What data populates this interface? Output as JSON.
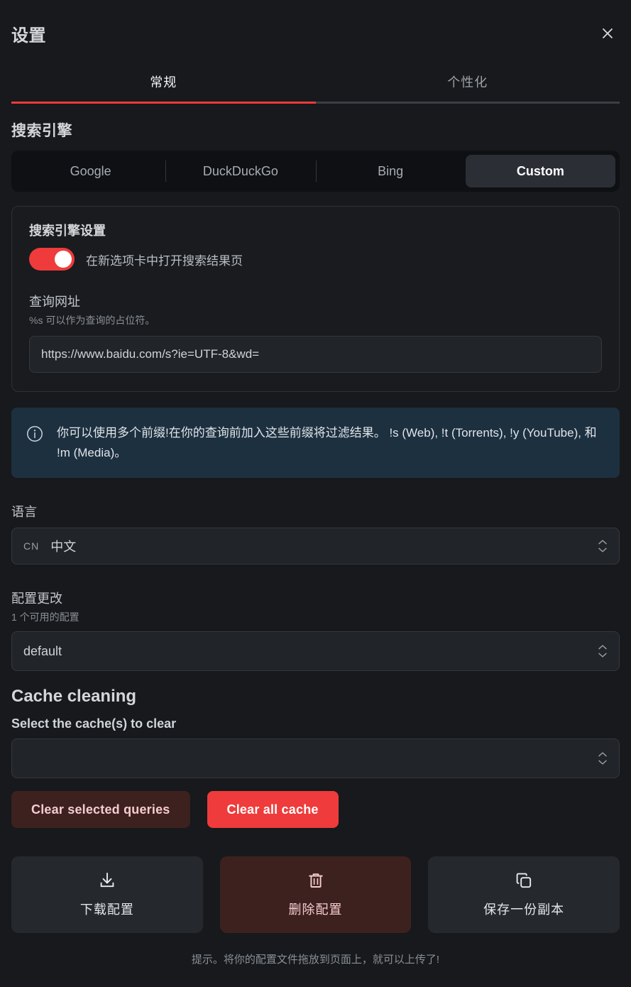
{
  "header": {
    "title": "设置",
    "close_icon": "close-icon"
  },
  "tabs": [
    {
      "label": "常规",
      "active": true
    },
    {
      "label": "个性化",
      "active": false
    }
  ],
  "search_engine": {
    "section_title": "搜索引擎",
    "options": [
      "Google",
      "DuckDuckGo",
      "Bing",
      "Custom"
    ],
    "selected": "Custom",
    "card": {
      "title": "搜索引擎设置",
      "toggle_label": "在新选项卡中打开搜索结果页",
      "toggle_on": true,
      "url_label": "查询网址",
      "url_hint": "%s 可以作为查询的占位符。",
      "url_value": "https://www.baidu.com/s?ie=UTF-8&wd=",
      "url_placeholder": "https://www.baidu.com/s?ie=UTF-8&wd="
    }
  },
  "info_banner": {
    "icon": "info-circle-icon",
    "text": "你可以使用多个前缀!在你的查询前加入这些前缀将过滤结果。 !s (Web), !t (Torrents), !y (YouTube), 和 !m (Media)。"
  },
  "language": {
    "label": "语言",
    "code": "CN",
    "value": "中文"
  },
  "config": {
    "label": "配置更改",
    "sub": "1 个可用的配置",
    "value": "default"
  },
  "cache": {
    "section_title": "Cache cleaning",
    "select_label": "Select the cache(s) to clear",
    "select_value": "",
    "clear_selected_label": "Clear selected queries",
    "clear_all_label": "Clear all cache"
  },
  "actions": [
    {
      "label": "下载配置",
      "icon": "download-icon",
      "style": "neutral"
    },
    {
      "label": "删除配置",
      "icon": "trash-icon",
      "style": "danger"
    },
    {
      "label": "保存一份副本",
      "icon": "copy-icon",
      "style": "neutral"
    }
  ],
  "footnote": "提示。将你的配置文件拖放到页面上，就可以上传了!",
  "colors": {
    "accent": "#ef3b3b",
    "background": "#17191c",
    "card": "#191b1f",
    "info_banner": "#1d3040",
    "danger_soft": "#3d211f"
  }
}
